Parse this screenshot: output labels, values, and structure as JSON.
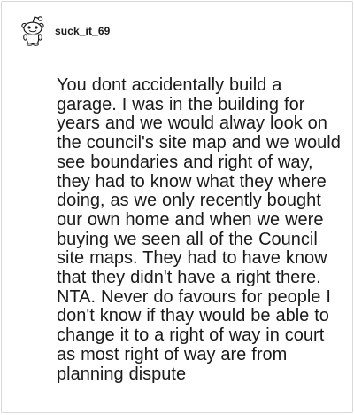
{
  "comment": {
    "username": "suck_it_69",
    "avatar_icon": "reddit-snoo-avatar-icon",
    "body": "You dont accidentally build a garage. I was in the building for years and we would alway look on the council's site map and we would see boundaries and right of way, they had to know what they where doing, as we only recently bought our own home and when we were buying we seen all of the Council site maps. They had to have know that they didn't have a right there. NTA. Never do favours for people I don't know if thay would be able to change it to a right of way in court as most right of way are from planning dispute"
  }
}
